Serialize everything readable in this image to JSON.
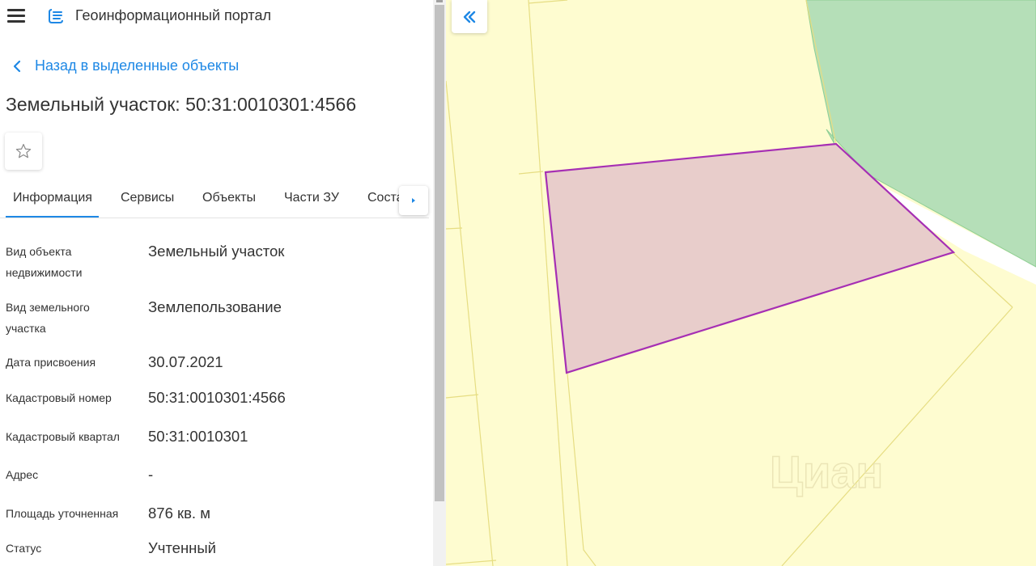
{
  "header": {
    "app_title": "Геоинформационный портал",
    "menu_icon": "hamburger-icon",
    "logo_icon": "portal-logo-icon"
  },
  "nav": {
    "back_label": "Назад в выделенные объекты"
  },
  "object": {
    "title": "Земельный участок: 50:31:0010301:4566"
  },
  "tabs": [
    {
      "label": "Информация",
      "active": true
    },
    {
      "label": "Сервисы",
      "active": false
    },
    {
      "label": "Объекты",
      "active": false
    },
    {
      "label": "Части ЗУ",
      "active": false
    },
    {
      "label": "Состав",
      "active": false
    }
  ],
  "properties": [
    {
      "label": "Вид объекта недвижимости",
      "value": "Земельный участок"
    },
    {
      "label": "Вид земельного участка",
      "value": "Землепользование"
    },
    {
      "label": "Дата присвоения",
      "value": "30.07.2021"
    },
    {
      "label": "Кадастровый номер",
      "value": "50:31:0010301:4566"
    },
    {
      "label": "Кадастровый квартал",
      "value": "50:31:0010301"
    },
    {
      "label": "Адрес",
      "value": "-"
    },
    {
      "label": "Площадь уточненная",
      "value": "876 кв. м"
    },
    {
      "label": "Статус",
      "value": "Учтенный"
    }
  ],
  "map": {
    "watermark": "Циан",
    "colors": {
      "parcel_fill": "#e8cdcb",
      "parcel_stroke": "#a62fb4",
      "land_fill": "#fefcd0",
      "forest_fill": "#b5dfb8",
      "line_color": "#e6dd82"
    }
  },
  "colors": {
    "accent": "#1e88e5",
    "text": "#333333"
  }
}
